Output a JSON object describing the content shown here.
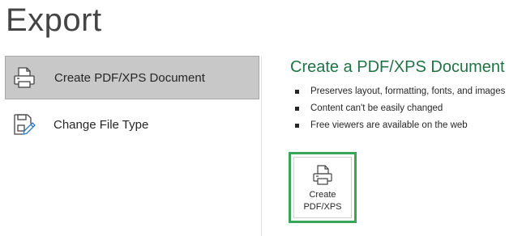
{
  "page": {
    "title": "Export"
  },
  "sidebar": {
    "items": [
      {
        "label": "Create PDF/XPS Document",
        "icon": "printer-document-icon",
        "selected": true
      },
      {
        "label": "Change File Type",
        "icon": "file-edit-icon",
        "selected": false
      }
    ]
  },
  "main": {
    "heading": "Create a PDF/XPS Document",
    "bullets": [
      "Preserves layout, formatting, fonts, and images",
      "Content can't be easily changed",
      "Free viewers are available on the web"
    ],
    "button": {
      "label": "Create\nPDF/XPS",
      "icon": "pdf-document-icon"
    }
  },
  "colors": {
    "accent": "#217346",
    "focus_border": "#3aa55a",
    "selected_bg": "#c8c8c8"
  }
}
